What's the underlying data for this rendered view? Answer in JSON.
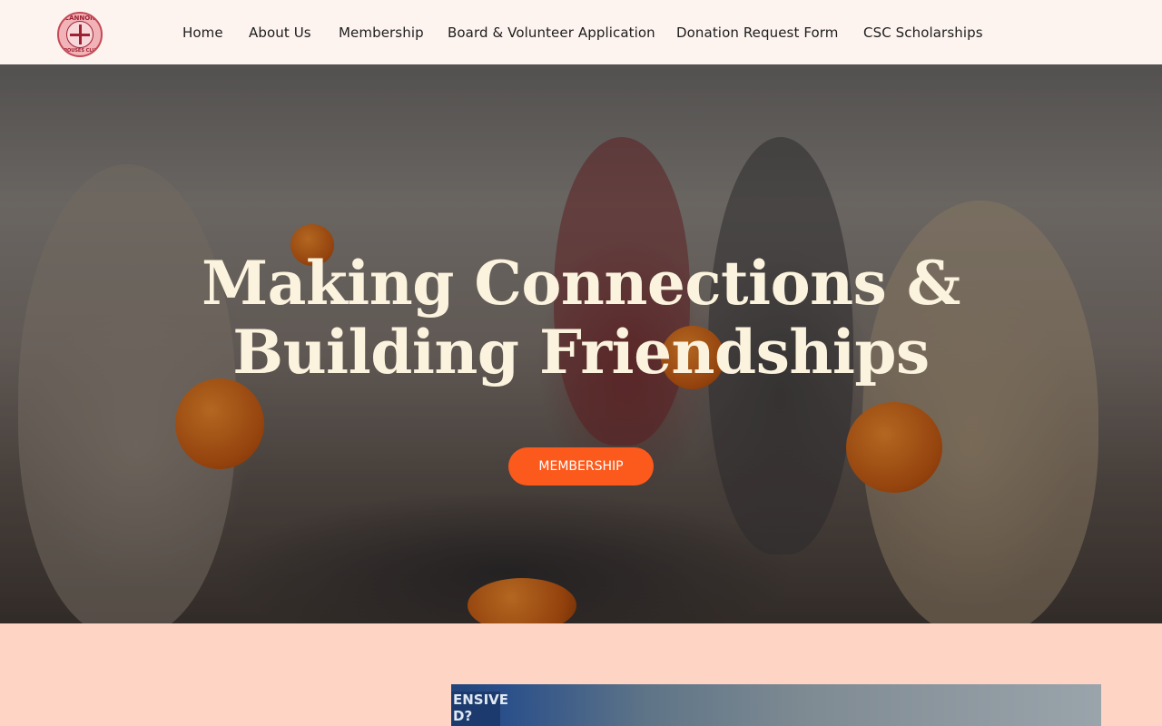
{
  "site": {
    "logo_top": "CANNON",
    "logo_bottom": "SPOUSES CLUB"
  },
  "nav": {
    "items": [
      {
        "label": "Home"
      },
      {
        "label": "About Us"
      },
      {
        "label": "Membership"
      },
      {
        "label": "Board & Volunteer Application"
      },
      {
        "label": "Donation Request Form"
      },
      {
        "label": "CSC Scholarships"
      }
    ]
  },
  "hero": {
    "title_line1": "Making Connections &",
    "title_line2": "Building Friendships",
    "button_label": "MEMBERSHIP"
  },
  "lower": {
    "image_sign": "ENSIVE\nD?"
  },
  "colors": {
    "header_bg": "#fdf4ef",
    "page_bg": "#fed4c5",
    "accent": "#fc5a1c",
    "hero_text": "#fbf3de"
  }
}
